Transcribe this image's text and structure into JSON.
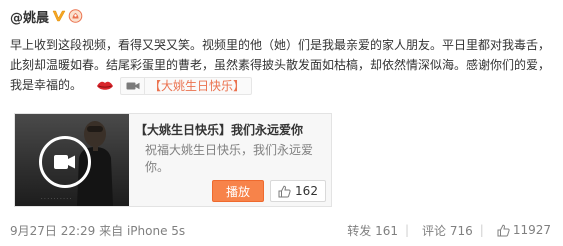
{
  "post": {
    "username": "@姚晨",
    "badges": [
      "verified-v-icon",
      "honor-badge-icon"
    ],
    "text": "早上收到这段视频，看得又哭又笑。视频里的他（她）们是我最亲爱的家人朋友。平日里都对我毒舌，此刻却温暖如春。结尾彩蛋里的曹老，虽然素得披头散发面如枯槁，却依然情深似海。感谢你们的爱，我是幸福的。",
    "inline_link_text": "【大姚生日快乐】"
  },
  "card": {
    "title": "【大姚生日快乐】我们永远爱你",
    "description": "祝福大姚生日快乐，我们永远爱你。",
    "play_label": "播放",
    "likes": "162"
  },
  "footer": {
    "time": "9月27日 22:29",
    "source": "来自 iPhone 5s",
    "reposts": "转发 161",
    "comments": "评论 716",
    "likes": "11927"
  },
  "colors": {
    "accent": "#eb7350",
    "play_button": "#f7834a"
  }
}
